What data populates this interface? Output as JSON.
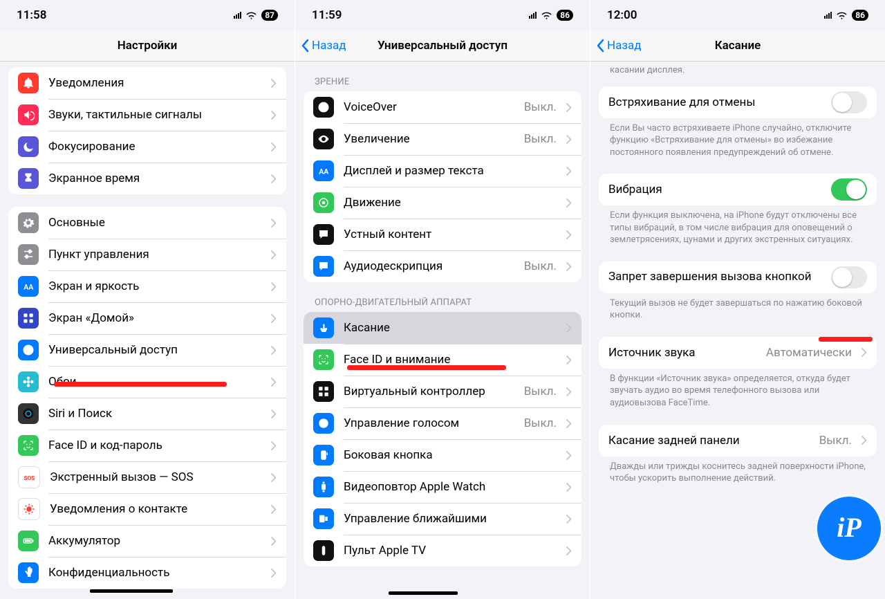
{
  "panel1": {
    "time": "11:58",
    "battery": "87",
    "title": "Настройки",
    "groupA": [
      {
        "name": "notifications",
        "label": "Уведомления",
        "iconBg": "#ff3b30"
      },
      {
        "name": "sounds",
        "label": "Звуки, тактильные сигналы",
        "iconBg": "#ff2d55"
      },
      {
        "name": "focus",
        "label": "Фокусирование",
        "iconBg": "#5856d6"
      },
      {
        "name": "screentime",
        "label": "Экранное время",
        "iconBg": "#5856d6"
      }
    ],
    "groupB": [
      {
        "name": "general",
        "label": "Основные",
        "iconBg": "#8e8e93"
      },
      {
        "name": "control-center",
        "label": "Пункт управления",
        "iconBg": "#8e8e93"
      },
      {
        "name": "display",
        "label": "Экран и яркость",
        "iconBg": "#007aff"
      },
      {
        "name": "home-screen",
        "label": "Экран «Домой»",
        "iconBg": "#3046c5"
      },
      {
        "name": "accessibility",
        "label": "Универсальный доступ",
        "iconBg": "#007aff",
        "highlight": true
      },
      {
        "name": "wallpaper",
        "label": "Обои",
        "iconBg": "#27bdd1"
      },
      {
        "name": "siri-search",
        "label": "Siri и Поиск",
        "iconBg": "#333"
      },
      {
        "name": "faceid",
        "label": "Face ID и код-пароль",
        "iconBg": "#34c759"
      },
      {
        "name": "sos",
        "label": "Экстренный вызов — SOS",
        "iconBg": "#ffffff"
      },
      {
        "name": "exposure",
        "label": "Уведомления о контакте",
        "iconBg": "#ffffff"
      },
      {
        "name": "battery",
        "label": "Аккумулятор",
        "iconBg": "#34c759"
      },
      {
        "name": "privacy",
        "label": "Конфиденциальность",
        "iconBg": "#007aff"
      }
    ]
  },
  "panel2": {
    "time": "11:59",
    "battery": "86",
    "back": "Назад",
    "title": "Универсальный доступ",
    "secVision": "ЗРЕНИЕ",
    "visionItems": [
      {
        "name": "voiceover",
        "label": "VoiceOver",
        "value": "Выкл.",
        "iconBg": "#111"
      },
      {
        "name": "zoom",
        "label": "Увеличение",
        "value": "Выкл.",
        "iconBg": "#111"
      },
      {
        "name": "display-text",
        "label": "Дисплей и размер текста",
        "iconBg": "#007aff"
      },
      {
        "name": "motion",
        "label": "Движение",
        "iconBg": "#34c759"
      },
      {
        "name": "spoken",
        "label": "Устный контент",
        "iconBg": "#111"
      },
      {
        "name": "audio-desc",
        "label": "Аудиодескрипция",
        "value": "Выкл.",
        "iconBg": "#007aff"
      }
    ],
    "secMotor": "ОПОРНО-ДВИГАТЕЛЬНЫЙ АППАРАТ",
    "motorItems": [
      {
        "name": "touch",
        "label": "Касание",
        "iconBg": "#007aff",
        "highlight": true,
        "selected": true
      },
      {
        "name": "faceid-attention",
        "label": "Face ID и внимание",
        "iconBg": "#34c759"
      },
      {
        "name": "switch-control",
        "label": "Виртуальный контроллер",
        "value": "Выкл.",
        "iconBg": "#111"
      },
      {
        "name": "voice-control",
        "label": "Управление голосом",
        "value": "Выкл.",
        "iconBg": "#007aff"
      },
      {
        "name": "side-button",
        "label": "Боковая кнопка",
        "iconBg": "#007aff"
      },
      {
        "name": "watch-mirror",
        "label": "Видеоповтор Apple Watch",
        "iconBg": "#007aff"
      },
      {
        "name": "nearby",
        "label": "Управление ближайшими",
        "iconBg": "#007aff"
      },
      {
        "name": "apple-tv-remote",
        "label": "Пульт Apple TV",
        "iconBg": "#111"
      }
    ]
  },
  "panel3": {
    "time": "12:00",
    "battery": "86",
    "back": "Назад",
    "title": "Касание",
    "topTail": "касании дисплея.",
    "shake": {
      "label": "Встряхивание для отмены",
      "on": false,
      "footer": "Если Вы часто встряхиваете iPhone случайно, отключите функцию «Встряхивание для отмены» во избежание постоянного появления предупреждений об отмене."
    },
    "vibration": {
      "label": "Вибрация",
      "on": true,
      "footer": "Если функция выключена, на iPhone будут отключены все типы вибраций, в том числе вибрация для оповещений о землетрясениях, цунами и других экстренных ситуациях."
    },
    "endcall": {
      "label": "Запрет завершения вызова кнопкой",
      "on": false,
      "highlight": true,
      "footer": "Текущий вызов не будет завершаться по нажатию боковой кнопки."
    },
    "audiosrc": {
      "label": "Источник звука",
      "value": "Автоматически",
      "footer": "В функции «Источник звука» определяется, откуда будет звучать аудио во время телефонного вызова или аудиовызова FaceTime."
    },
    "backtap": {
      "label": "Касание задней панели",
      "value": "Выкл.",
      "footer": "Дважды или трижды коснитесь задней поверхности iPhone, чтобы ускорить выполнение действий."
    }
  }
}
